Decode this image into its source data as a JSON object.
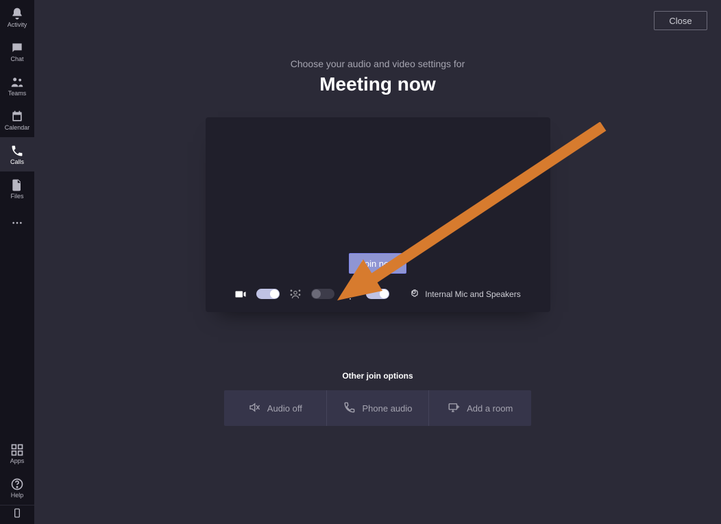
{
  "sidebar": {
    "top": [
      {
        "icon": "bell",
        "label": "Activity"
      },
      {
        "icon": "chat",
        "label": "Chat"
      },
      {
        "icon": "teams",
        "label": "Teams"
      },
      {
        "icon": "calendar",
        "label": "Calendar"
      },
      {
        "icon": "calls",
        "label": "Calls",
        "selected": true
      },
      {
        "icon": "files",
        "label": "Files"
      },
      {
        "icon": "more",
        "label": ""
      }
    ],
    "bottom": [
      {
        "icon": "apps",
        "label": "Apps"
      },
      {
        "icon": "help",
        "label": "Help"
      }
    ]
  },
  "close_label": "Close",
  "heading": {
    "subtitle": "Choose your audio and video settings for",
    "title": "Meeting now"
  },
  "join_label": "Join now",
  "controls": {
    "camera_on": true,
    "blur_on": false,
    "mic_on": true,
    "device_label": "Internal Mic and Speakers"
  },
  "other_title": "Other join options",
  "options": [
    {
      "icon": "audio-off",
      "label": "Audio off"
    },
    {
      "icon": "phone",
      "label": "Phone audio"
    },
    {
      "icon": "room",
      "label": "Add a room"
    }
  ],
  "annotation": {
    "color": "#d77b2e"
  }
}
